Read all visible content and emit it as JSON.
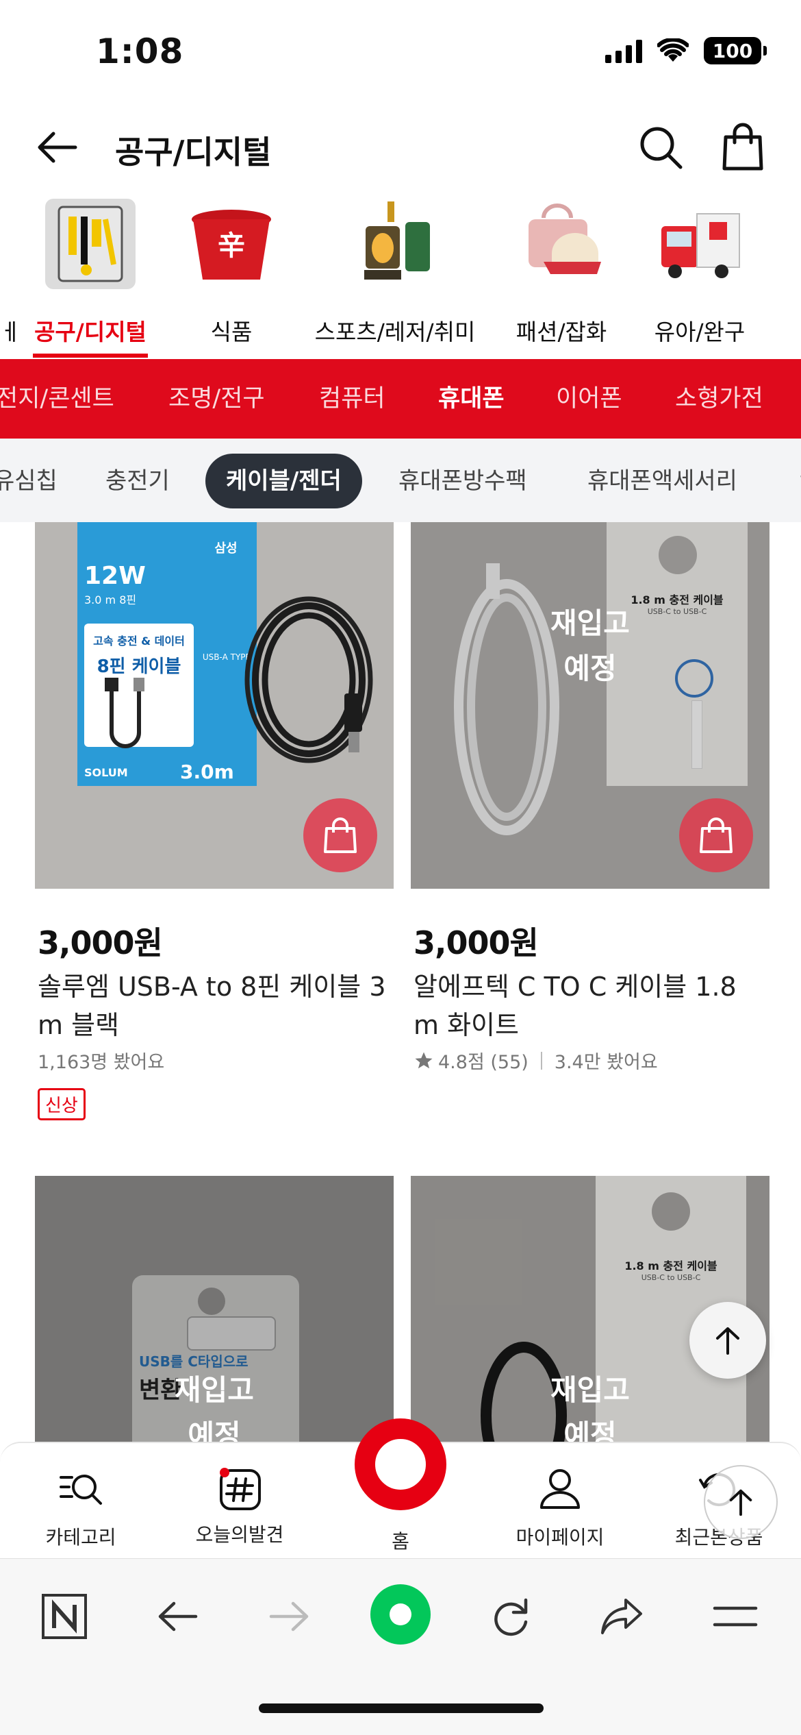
{
  "status_bar": {
    "time": "1:08",
    "battery": "100"
  },
  "header": {
    "title": "공구/디지털"
  },
  "categories": [
    {
      "label": "공구/디지털",
      "active": true
    },
    {
      "label": "식품"
    },
    {
      "label": "스포츠/레저/취미"
    },
    {
      "label": "패션/잡화"
    },
    {
      "label": "유아/완구"
    }
  ],
  "subcategories": [
    "전지/콘센트",
    "조명/전구",
    "컴퓨터",
    "휴대폰",
    "이어폰",
    "소형가전"
  ],
  "subcategory_active": "휴대폰",
  "chips": [
    "유심칩",
    "충전기",
    "케이블/젠더",
    "휴대폰방수팩",
    "휴대폰액세서리"
  ],
  "chip_active": "케이블/젠더",
  "products": [
    {
      "price": "3,000원",
      "name": "솔루엠 USB-A to 8핀 케이블 3 m 블랙",
      "views": "1,163명 봤어요",
      "badge": "신상",
      "package_text": {
        "spec": "12W",
        "length": "3.0 m 8핀",
        "brand": "삼성",
        "headline": "고속 충전 & 데이터",
        "title": "8핀 케이블",
        "type": "USB-A TYPE",
        "logo": "SOLUM",
        "bottom": "3.0m"
      }
    },
    {
      "price": "3,000원",
      "name": "알에프텍 C TO C 케이블 1.8 m 화이트",
      "rating": "4.8점 (55)",
      "views": "3.4만 봤어요",
      "overlay": "재입고\n예정",
      "package_text": {
        "title": "1.8 m 충전 케이블",
        "sub": "USB-C to USB-C"
      }
    },
    {
      "overlay": "재입고\n예정",
      "package_text": {
        "line1": "USB를 C타입으로",
        "line2": "변환"
      }
    },
    {
      "overlay": "재입고\n예정",
      "package_text": {
        "title": "1.8 m 충전 케이블",
        "sub": "USB-C to USB-C"
      }
    }
  ],
  "bottom_nav": {
    "category": "카테고리",
    "discover": "오늘의발견",
    "home": "홈",
    "mypage": "마이페이지",
    "recent": "최근본상품"
  },
  "colors": {
    "accent": "#e60012",
    "chip_active_bg": "#2b313a",
    "naver_green": "#03c75a"
  }
}
